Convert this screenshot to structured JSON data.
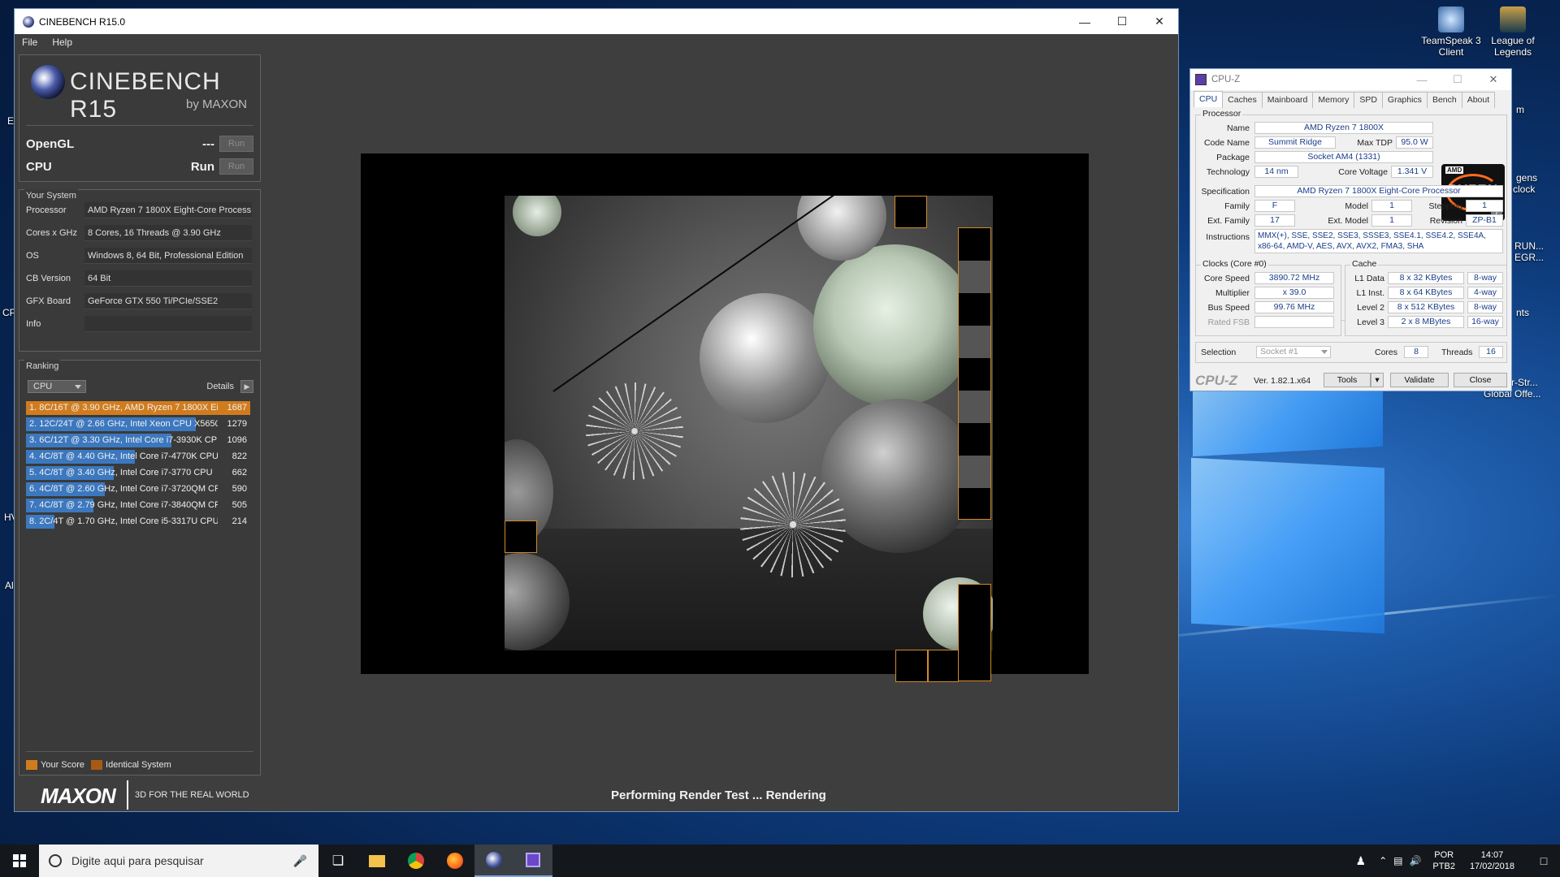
{
  "desktop": {
    "icons": [
      {
        "label_line1": "TeamSpeak 3",
        "label_line2": "Client"
      },
      {
        "label_line1": "League of",
        "label_line2": "Legends"
      }
    ],
    "edge_labels": [
      "E",
      "CP",
      "HV",
      "Al",
      "gens",
      "clock",
      "RUN...",
      "EGR...",
      "nts",
      "r-Str...",
      "Global Offe...",
      "m"
    ]
  },
  "cinebench": {
    "title": "CINEBENCH R15.0",
    "menu": [
      "File",
      "Help"
    ],
    "logo": {
      "name": "CINEBENCH R15",
      "sub": "by MAXON"
    },
    "bench": [
      {
        "label": "OpenGL",
        "value": "---",
        "button": "Run"
      },
      {
        "label": "CPU",
        "value": "Run",
        "button": "Run"
      }
    ],
    "your_system": {
      "title": "Your System",
      "rows": [
        {
          "key": "Processor",
          "value": "AMD Ryzen 7 1800X Eight-Core Process"
        },
        {
          "key": "Cores x GHz",
          "value": "8 Cores, 16 Threads @ 3.90 GHz"
        },
        {
          "key": "OS",
          "value": "Windows 8, 64 Bit, Professional Edition"
        },
        {
          "key": "CB Version",
          "value": "64 Bit"
        },
        {
          "key": "GFX Board",
          "value": "GeForce GTX 550 Ti/PCIe/SSE2"
        },
        {
          "key": "Info",
          "value": ""
        }
      ]
    },
    "ranking": {
      "title": "Ranking",
      "select": "CPU",
      "details": "Details",
      "items": [
        {
          "text": "1. 8C/16T @ 3.90 GHz, AMD Ryzen 7 1800X Ei",
          "score": "1687",
          "bar": 1.0,
          "mine": true
        },
        {
          "text": "2. 12C/24T @ 2.66 GHz, Intel Xeon CPU X5650",
          "score": "1279",
          "bar": 0.758,
          "mine": false
        },
        {
          "text": "3. 6C/12T @ 3.30 GHz,  Intel Core i7-3930K CP",
          "score": "1096",
          "bar": 0.65,
          "mine": false
        },
        {
          "text": "4. 4C/8T @ 4.40 GHz, Intel Core i7-4770K CPU",
          "score": "822",
          "bar": 0.487,
          "mine": false
        },
        {
          "text": "5. 4C/8T @ 3.40 GHz,  Intel Core i7-3770 CPU",
          "score": "662",
          "bar": 0.392,
          "mine": false
        },
        {
          "text": "6. 4C/8T @ 2.60 GHz, Intel Core i7-3720QM CPI",
          "score": "590",
          "bar": 0.35,
          "mine": false
        },
        {
          "text": "7. 4C/8T @ 2.79 GHz,  Intel Core i7-3840QM CP",
          "score": "505",
          "bar": 0.299,
          "mine": false
        },
        {
          "text": "8. 2C/4T @ 1.70 GHz,  Intel Core i5-3317U CPU",
          "score": "214",
          "bar": 0.127,
          "mine": false
        }
      ],
      "legend": [
        "Your Score",
        "Identical System"
      ]
    },
    "footer": {
      "brand": "MAXON",
      "tagline": "3D FOR THE REAL WORLD",
      "status": "Performing Render Test ... Rendering"
    },
    "colors": {
      "your_score": "#d07c1e",
      "identical": "#a85a14",
      "bar": "#3c78bf"
    }
  },
  "cpuz": {
    "title": "CPU-Z",
    "tabs": [
      "CPU",
      "Caches",
      "Mainboard",
      "Memory",
      "SPD",
      "Graphics",
      "Bench",
      "About"
    ],
    "processor": {
      "section": "Processor",
      "name_label": "Name",
      "name": "AMD Ryzen 7 1800X",
      "codename_label": "Code Name",
      "codename": "Summit Ridge",
      "maxtdp_label": "Max TDP",
      "maxtdp": "95.0 W",
      "package_label": "Package",
      "package": "Socket AM4 (1331)",
      "tech_label": "Technology",
      "tech": "14 nm",
      "voltage_label": "Core Voltage",
      "voltage": "1.341 V",
      "spec_label": "Specification",
      "spec": "AMD Ryzen 7 1800X Eight-Core Processor",
      "family_label": "Family",
      "family": "F",
      "model_label": "Model",
      "model": "1",
      "stepping_label": "Stepping",
      "stepping": "1",
      "extfamily_label": "Ext. Family",
      "extfamily": "17",
      "extmodel_label": "Ext. Model",
      "extmodel": "1",
      "revision_label": "Revision",
      "revision": "ZP-B1",
      "instr_label": "Instructions",
      "instr_line1": "MMX(+), SSE, SSE2, SSE3, SSSE3, SSE4.1, SSE4.2, SSE4A,",
      "instr_line2": "x86-64, AMD-V, AES, AVX, AVX2, FMA3, SHA"
    },
    "logo": {
      "amd": "AMD",
      "ryzen": "RYZEN",
      "tier": "7"
    },
    "clocks": {
      "section": "Clocks (Core #0)",
      "speed_label": "Core Speed",
      "speed": "3890.72 MHz",
      "mult_label": "Multiplier",
      "mult": "x 39.0",
      "bus_label": "Bus Speed",
      "bus": "99.76 MHz",
      "fsb_label": "Rated FSB",
      "fsb": ""
    },
    "cache": {
      "section": "Cache",
      "rows": [
        {
          "label": "L1 Data",
          "size": "8 x 32 KBytes",
          "way": "8-way"
        },
        {
          "label": "L1 Inst.",
          "size": "8 x 64 KBytes",
          "way": "4-way"
        },
        {
          "label": "Level 2",
          "size": "8 x 512 KBytes",
          "way": "8-way"
        },
        {
          "label": "Level 3",
          "size": "2 x 8 MBytes",
          "way": "16-way"
        }
      ]
    },
    "selection_label": "Selection",
    "selection": "Socket #1",
    "cores_label": "Cores",
    "cores": "8",
    "threads_label": "Threads",
    "threads": "16",
    "footer": {
      "brand": "CPU-Z",
      "version": "Ver. 1.82.1.x64",
      "tools": "Tools",
      "validate": "Validate",
      "close": "Close"
    }
  },
  "taskbar": {
    "search_placeholder": "Digite aqui para pesquisar",
    "lang1": "POR",
    "lang2": "PTB2",
    "time": "14:07",
    "date": "17/02/2018"
  }
}
